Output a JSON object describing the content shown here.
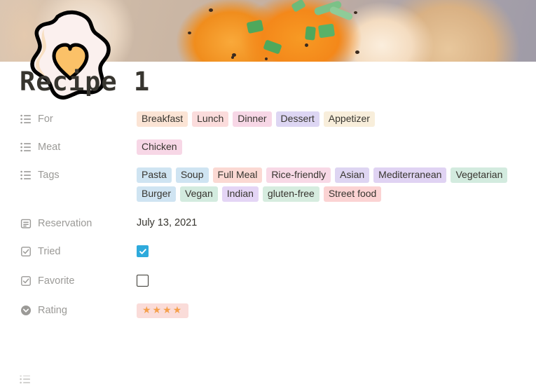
{
  "cover": {
    "icon_name": "fried-egg-heart-icon",
    "description": "Food photograph cover: fried eggs with orange yolks, green onion slices and black pepper"
  },
  "page": {
    "title": "Recipe 1"
  },
  "properties": [
    {
      "id": "for",
      "label": "For",
      "icon": "multi-select-list-icon",
      "type": "multi_select",
      "tags": [
        {
          "label": "Breakfast",
          "bg": "#fbe4d5",
          "fg": "#37352f"
        },
        {
          "label": "Lunch",
          "bg": "#fbdcdc",
          "fg": "#37352f"
        },
        {
          "label": "Dinner",
          "bg": "#f7d7e6",
          "fg": "#37352f"
        },
        {
          "label": "Dessert",
          "bg": "#ddd6f3",
          "fg": "#37352f"
        },
        {
          "label": "Appetizer",
          "bg": "#f8eedb",
          "fg": "#37352f"
        }
      ]
    },
    {
      "id": "meat",
      "label": "Meat",
      "icon": "multi-select-list-icon",
      "type": "multi_select",
      "tags": [
        {
          "label": "Chicken",
          "bg": "#f7d7e6",
          "fg": "#37352f"
        }
      ]
    },
    {
      "id": "tags",
      "label": "Tags",
      "icon": "multi-select-list-icon",
      "type": "multi_select",
      "tags": [
        {
          "label": "Pasta",
          "bg": "#cfe4f2",
          "fg": "#37352f"
        },
        {
          "label": "Soup",
          "bg": "#cfe4f2",
          "fg": "#37352f"
        },
        {
          "label": "Full Meal",
          "bg": "#fbd9d3",
          "fg": "#37352f"
        },
        {
          "label": "Rice-friendly",
          "bg": "#f8d9e6",
          "fg": "#37352f"
        },
        {
          "label": "Asian",
          "bg": "#ded5f2",
          "fg": "#37352f"
        },
        {
          "label": "Mediterranean",
          "bg": "#e0d3f3",
          "fg": "#37352f"
        },
        {
          "label": "Vegetarian",
          "bg": "#d3ebdf",
          "fg": "#37352f"
        },
        {
          "label": "Burger",
          "bg": "#cfe4f2",
          "fg": "#37352f"
        },
        {
          "label": "Vegan",
          "bg": "#d3ebdf",
          "fg": "#37352f"
        },
        {
          "label": "Indian",
          "bg": "#e4d5f5",
          "fg": "#37352f"
        },
        {
          "label": "gluten-free",
          "bg": "#d6ecdf",
          "fg": "#37352f"
        },
        {
          "label": "Street food",
          "bg": "#fbd3d3",
          "fg": "#37352f"
        }
      ]
    },
    {
      "id": "reservation",
      "label": "Reservation",
      "icon": "calendar-icon",
      "type": "date",
      "value": "July 13, 2021"
    },
    {
      "id": "tried",
      "label": "Tried",
      "icon": "checkbox-icon",
      "type": "checkbox",
      "checked": true
    },
    {
      "id": "favorite",
      "label": "Favorite",
      "icon": "checkbox-icon",
      "type": "checkbox",
      "checked": false
    },
    {
      "id": "rating",
      "label": "Rating",
      "icon": "select-circle-chevron-icon",
      "type": "select",
      "value": "★★★★",
      "stars": 4,
      "badge_bg": "#fadcd9",
      "star_color": "#f5a04b"
    }
  ],
  "colors": {
    "text": "#37352f",
    "muted": "#9b9a97",
    "checkbox_checked": "#2eaadc",
    "page_background": "#ffffff"
  }
}
